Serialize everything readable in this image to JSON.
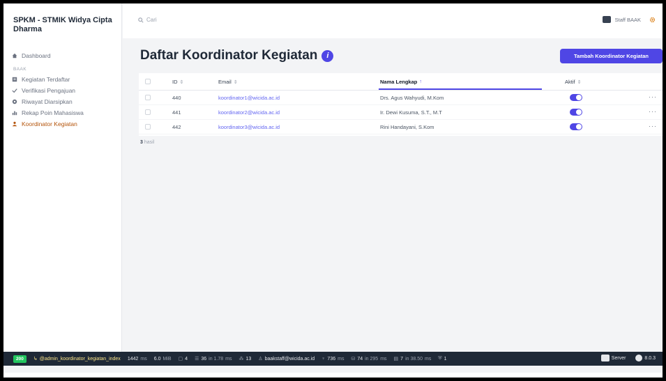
{
  "brand": {
    "title": "SPKM - STMIK Widya Cipta Dharma"
  },
  "sidebar": {
    "dashboard": "Dashboard",
    "group_label": "BAAK",
    "items": [
      {
        "label": "Kegiatan Terdaftar",
        "icon": "clipboard-icon"
      },
      {
        "label": "Verifikasi Pengajuan",
        "icon": "check-badge-icon"
      },
      {
        "label": "Riwayat Diarsipkan",
        "icon": "archive-icon"
      },
      {
        "label": "Rekap Poin Mahasiswa",
        "icon": "chart-bar-icon"
      },
      {
        "label": "Koordinator Kegiatan",
        "icon": "user-icon",
        "active": true
      }
    ]
  },
  "topbar": {
    "search_placeholder": "Cari",
    "user_name": "Staff BAAK"
  },
  "page": {
    "title": "Daftar Koordinator Kegiatan",
    "add_button": "Tambah Koordinator Kegiatan",
    "result_count": "3",
    "result_suffix": "hasil"
  },
  "table": {
    "headers": {
      "id": "ID",
      "email": "Email",
      "name": "Nama Lengkap",
      "active": "Aktif"
    },
    "sorted_column": "name",
    "rows": [
      {
        "id": "440",
        "email": "koordinator1@wicida.ac.id",
        "name": "Drs. Agus Wahyudi, M.Kom",
        "active": true
      },
      {
        "id": "441",
        "email": "koordinator2@wicida.ac.id",
        "name": "Ir. Dewi Kusuma, S.T., M.T",
        "active": true
      },
      {
        "id": "442",
        "email": "koordinator3@wicida.ac.id",
        "name": "Rini Handayani, S.Kom",
        "active": true
      }
    ]
  },
  "debugbar": {
    "status": "200",
    "route": "@admin_koordinator_kegiatan_index",
    "time": "1442",
    "time_unit": "ms",
    "memory": "6.0",
    "memory_unit": "MiB",
    "forms": "4",
    "cache": "36",
    "cache_detail": "in 1.78",
    "cache_unit": "ms",
    "translations": "13",
    "user": "baakstaff@wicida.ac.id",
    "twig": "736",
    "twig_unit": "ms",
    "db": "74",
    "db_detail": "in 295",
    "db_unit": "ms",
    "queries": "7",
    "queries_detail": "in 38.50",
    "queries_unit": "ms",
    "security": "1",
    "server": "Server",
    "version": "8.0.3"
  }
}
